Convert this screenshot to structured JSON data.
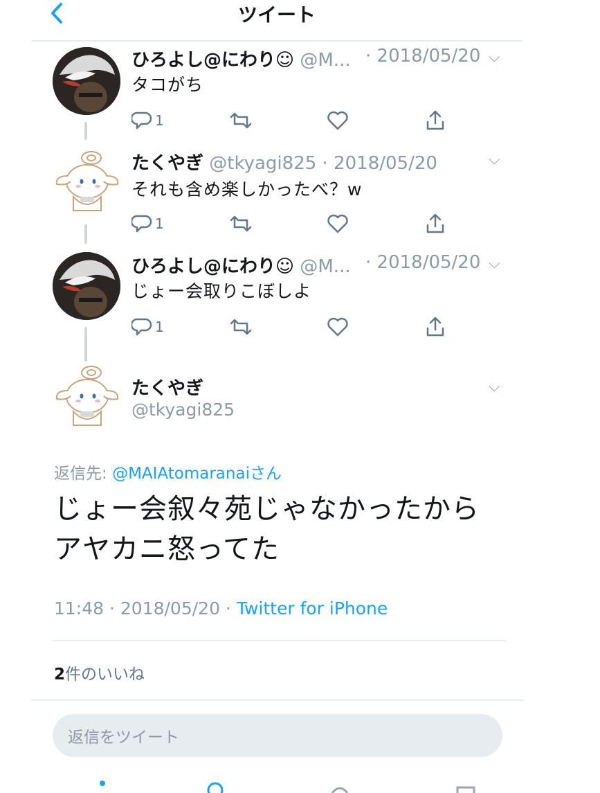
{
  "header": {
    "title": "ツイート"
  },
  "thread": [
    {
      "name": "ひろよし@にわり☺",
      "handle": "@M...",
      "date": "· 2018/05/20",
      "text": "タコがち",
      "reply_count": "1"
    },
    {
      "name": "たくやぎ",
      "handle": "@tkyagi825",
      "date": "· 2018/05/20",
      "text": "それも含め楽しかったべ？w",
      "reply_count": "1"
    },
    {
      "name": "ひろよし@にわり☺",
      "handle": "@M...",
      "date": "· 2018/05/20",
      "text": "じょー会取りこぼしよ",
      "reply_count": "1"
    }
  ],
  "main_tweet": {
    "name": "たくやぎ",
    "handle": "@tkyagi825",
    "reply_to_label": "返信先: ",
    "reply_to_handle": "@MAIAtomaranaiさん",
    "text_line1": "じょー会叙々苑じゃなかったから",
    "text_line2": "アヤカニ怒ってた",
    "timestamp": "11:48 · 2018/05/20 · ",
    "source": "Twitter for iPhone",
    "likes_count": "2",
    "likes_label": "件のいいね"
  },
  "reply_box": {
    "placeholder": "返信をツイート"
  },
  "icons": {
    "back": "chevron-left-icon",
    "reply": "reply-icon",
    "retweet": "retweet-icon",
    "like": "heart-icon",
    "share": "share-icon",
    "more": "chevron-down-icon"
  },
  "colors": {
    "accent": "#1da1f2",
    "secondary_text": "#8d9aa3",
    "rule": "#e6ecf0"
  }
}
